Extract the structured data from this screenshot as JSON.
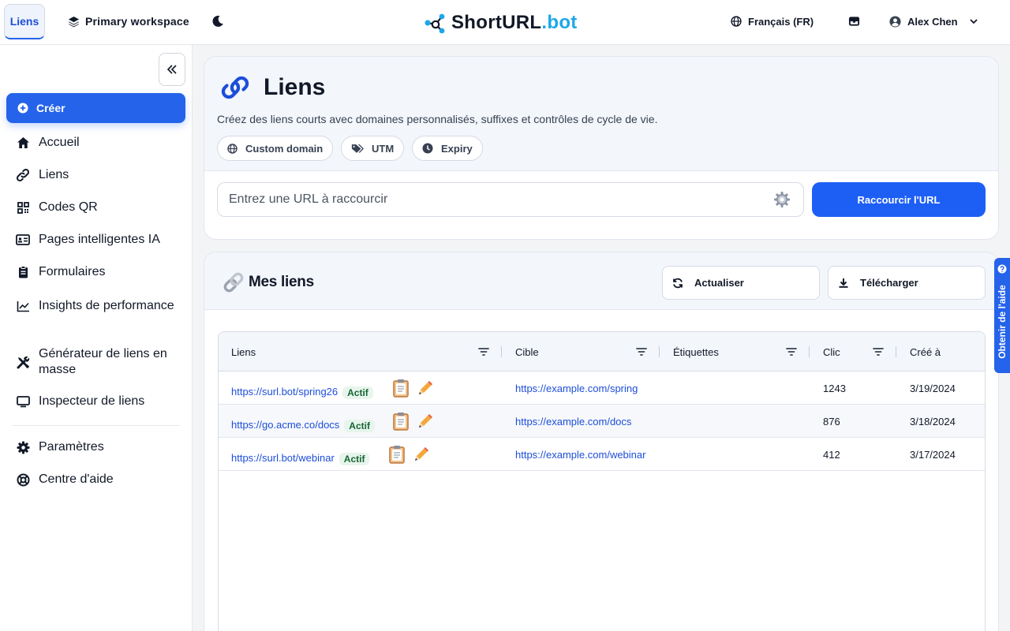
{
  "topbar": {
    "tab_label": "Liens",
    "workspace": "Primary workspace",
    "logo_main": "ShortURL",
    "logo_suffix": ".bot",
    "language": "Français (FR)",
    "user_name": "Alex Chen"
  },
  "sidebar": {
    "create_label": "Créer",
    "items": [
      {
        "label": "Accueil",
        "icon": "home-icon"
      },
      {
        "label": "Liens",
        "icon": "link-icon"
      },
      {
        "label": "Codes QR",
        "icon": "qr-code-icon"
      },
      {
        "label": "Pages intelligentes IA",
        "icon": "id-card-icon"
      },
      {
        "label": "Formulaires",
        "icon": "clipboard-icon"
      },
      {
        "label": "Insights de performance",
        "icon": "line-chart-icon"
      },
      {
        "label": "Générateur de liens en masse",
        "icon": "tools-icon"
      },
      {
        "label": "Inspecteur de liens",
        "icon": "monitor-icon"
      },
      {
        "label": "Paramètres",
        "icon": "gear-icon"
      },
      {
        "label": "Centre d'aide",
        "icon": "lifebuoy-icon"
      }
    ]
  },
  "main": {
    "title": "Liens",
    "description": "Créez des liens courts avec domaines personnalisés, suffixes et contrôles de cycle de vie.",
    "chips": [
      "Custom domain",
      "UTM",
      "Expiry"
    ],
    "url_placeholder": "Entrez une URL à raccourcir",
    "shorten_label": "Raccourcir l'URL",
    "section_title": "Mes liens",
    "refresh_label": "Actualiser",
    "download_label": "Télécharger",
    "table": {
      "columns": [
        "Liens",
        "Cible",
        "Étiquettes",
        "Clic",
        "Créé à"
      ],
      "rows": [
        {
          "link": "https://surl.bot/spring26",
          "status": "Actif",
          "target": "https://example.com/spring",
          "tags": "",
          "clicks": "1243",
          "created": "3/19/2024"
        },
        {
          "link": "https://go.acme.co/docs",
          "status": "Actif",
          "target": "https://example.com/docs",
          "tags": "",
          "clicks": "876",
          "created": "3/18/2024"
        },
        {
          "link": "https://surl.bot/webinar",
          "status": "Actif",
          "target": "https://example.com/webinar",
          "tags": "",
          "clicks": "412",
          "created": "3/17/2024"
        }
      ]
    }
  },
  "help_tab": "Obtenir de l'aide",
  "colors": {
    "primary": "#2563eb",
    "logo_accent": "#1ea7e8",
    "badge_bg": "#e7f5ec",
    "badge_fg": "#166534"
  }
}
